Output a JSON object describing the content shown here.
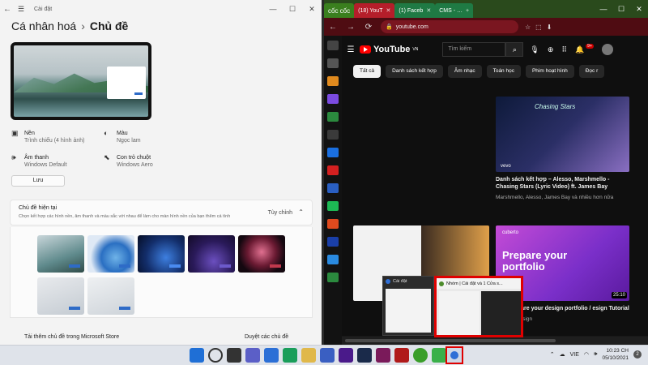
{
  "settings": {
    "window_title": "Cài đặt",
    "breadcrumb": {
      "parent": "Cá nhân hoá",
      "separator": "›",
      "current": "Chủ đề"
    },
    "props": [
      {
        "label": "Nền",
        "value": "Trình chiếu (4 hình ảnh)",
        "icon": "picture-icon"
      },
      {
        "label": "Màu",
        "value": "Ngọc lam",
        "icon": "palette-icon"
      },
      {
        "label": "Âm thanh",
        "value": "Windows Default",
        "icon": "speaker-icon"
      },
      {
        "label": "Con trỏ chuột",
        "value": "Windows Aero",
        "icon": "cursor-icon"
      }
    ],
    "save_label": "Lưu",
    "current_theme": {
      "title": "Chủ đề hiện tại",
      "desc": "Chọn kết hợp các hình nền, âm thanh và màu sắc với nhau để làm cho màn hình nền của bạn thêm cá tính",
      "customize": "Tùy chỉnh"
    },
    "store_row": "Tải thêm chủ đề trong Microsoft Store",
    "browse": "Duyệt các chủ đề"
  },
  "browser": {
    "tabs": [
      {
        "label": "cốc cốc"
      },
      {
        "label": "(18) YouT",
        "active": true
      },
      {
        "label": "(1) Faceb"
      },
      {
        "label": "CMS - …"
      }
    ],
    "url": "youtube.com",
    "youtube": {
      "logo": "YouTube",
      "logo_sup": "VN",
      "search_placeholder": "Tìm kiếm",
      "notif_count": "9+",
      "chips": [
        "Tất cả",
        "Danh sách kết hợp",
        "Âm nhạc",
        "Toán học",
        "Phim hoạt hình",
        "Đọc r"
      ],
      "videos": [
        {
          "title": "Danh sách kết hợp – Alesso, Marshmello - Chasing Stars (Lyric Video) ft. James Bay",
          "meta": "Marshmello, Alesso, James Bay và nhiều hơn nữa",
          "thumb_text": "Chasing Stars",
          "thumb_brand": "vevo"
        },
        {
          "title": "How to prepare your design portfolio / Design Tutorial",
          "title_visible": "w to prepare your design portfolio / esign Tutorial",
          "meta": "Cuberto Design",
          "duration": "25:10",
          "thumb_brand": "cuberto",
          "thumb_text": "Prepare your portfolio"
        }
      ]
    }
  },
  "snap_popup": {
    "label_small": "Cài đặt",
    "label": "Nhóm | Cài đặt và 1 Cửa s..."
  },
  "taskbar": {
    "language": "VIE",
    "time": "10:23 CH",
    "date": "05/10/2021",
    "notif_count": "2",
    "highlight_color": "#e00000"
  }
}
